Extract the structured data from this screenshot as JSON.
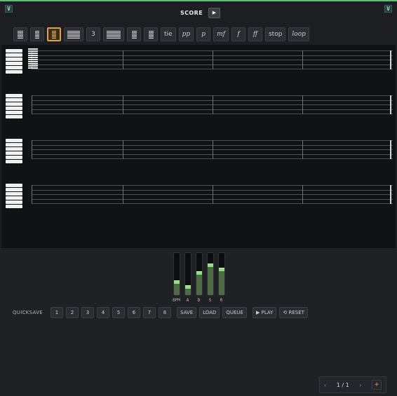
{
  "header": {
    "title": "SCORE",
    "play_icon": "▶",
    "left_corner_icon": "V",
    "right_corner_icon": "V"
  },
  "toolbar": {
    "items": [
      {
        "kind": "glyph",
        "icon": "whole-note-icon"
      },
      {
        "kind": "glyph",
        "icon": "half-note-icon"
      },
      {
        "kind": "glyph",
        "icon": "quarter-note-icon",
        "selected": true
      },
      {
        "kind": "glyph",
        "icon": "eighth-note-icon"
      },
      {
        "kind": "text",
        "label": "3"
      },
      {
        "kind": "glyph",
        "icon": "sixteenth-note-icon"
      },
      {
        "kind": "glyph",
        "icon": "rest-icon"
      },
      {
        "kind": "glyph",
        "icon": "dotted-icon"
      },
      {
        "kind": "text",
        "label": "tie"
      },
      {
        "kind": "text",
        "label": "pp",
        "italic": true
      },
      {
        "kind": "text",
        "label": "p",
        "italic": true
      },
      {
        "kind": "text",
        "label": "mf",
        "italic": true
      },
      {
        "kind": "text",
        "label": "f",
        "italic": true
      },
      {
        "kind": "text",
        "label": "ff",
        "italic": true
      },
      {
        "kind": "text",
        "label": "stop"
      },
      {
        "kind": "text",
        "label": "loop",
        "italic": true
      }
    ]
  },
  "controls": {
    "sliders": [
      {
        "label": "BPM",
        "value": 0.3
      },
      {
        "label": "A",
        "value": 0.18
      },
      {
        "label": "D",
        "value": 0.52
      },
      {
        "label": "S",
        "value": 0.7
      },
      {
        "label": "R",
        "value": 0.6
      }
    ],
    "quicksave_label": "QUICKSAVE",
    "slots": [
      "1",
      "2",
      "3",
      "4",
      "5",
      "6",
      "7",
      "8"
    ],
    "save_label": "SAVE",
    "load_label": "LOAD",
    "queue_label": "QUEUE",
    "play_label": "▶ PLAY",
    "reset_label": "⟲ RESET"
  },
  "pager": {
    "prev": "‹",
    "page": "1 / 1",
    "next": "›",
    "add": "+"
  },
  "colors": {
    "accent": "#5fbf73",
    "selected": "#e0a43a",
    "slider_thumb": "#8de07a"
  }
}
